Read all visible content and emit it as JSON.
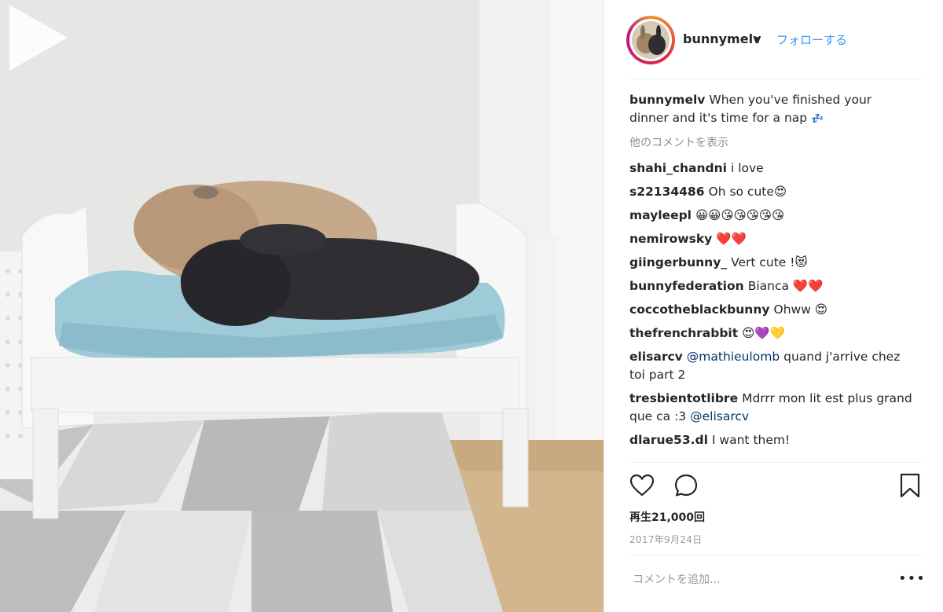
{
  "header": {
    "username": "bunnymelv",
    "dot": "•",
    "follow_label": "フォローする"
  },
  "caption": {
    "username": "bunnymelv",
    "text": "When you've finished your dinner and it's time for a nap",
    "emoji": "💤"
  },
  "more_comments_label": "他のコメントを表示",
  "comments": [
    {
      "username": "shahi_chandni",
      "text": "i love"
    },
    {
      "username": "s22134486",
      "text": "Oh so cute😍"
    },
    {
      "username": "mayleepl",
      "text": "😀😀😘😘😘😘😘"
    },
    {
      "username": "nemirowsky",
      "text": "❤️❤️"
    },
    {
      "username": "giingerbunny_",
      "text": "Vert cute !😻"
    },
    {
      "username": "bunnyfederation",
      "text": "Bianca ❤️❤️"
    },
    {
      "username": "coccotheblackbunny",
      "text": "Ohww 😍"
    },
    {
      "username": "thefrenchrabbit",
      "text": "😍💜💛"
    },
    {
      "username": "elisarcv",
      "mention": "@mathieulomb",
      "text": "quand j'arrive chez toi part 2"
    },
    {
      "username": "tresbientotlibre",
      "text": "Mdrrr mon lit est plus grand que ca :3",
      "mention": "@elisarcv"
    },
    {
      "username": "dlarue53.dl",
      "text": "I want them!"
    }
  ],
  "actions": {
    "like_icon": "heart-icon",
    "comment_icon": "speech-bubble-icon",
    "save_icon": "bookmark-icon"
  },
  "views_label": "再生21,000回",
  "date_label": "2017年9月24日",
  "comment_placeholder": "コメントを追加...",
  "more_label": "•••",
  "colors": {
    "link": "#3897f0",
    "muted": "#8e8e8e",
    "text": "#262626"
  }
}
